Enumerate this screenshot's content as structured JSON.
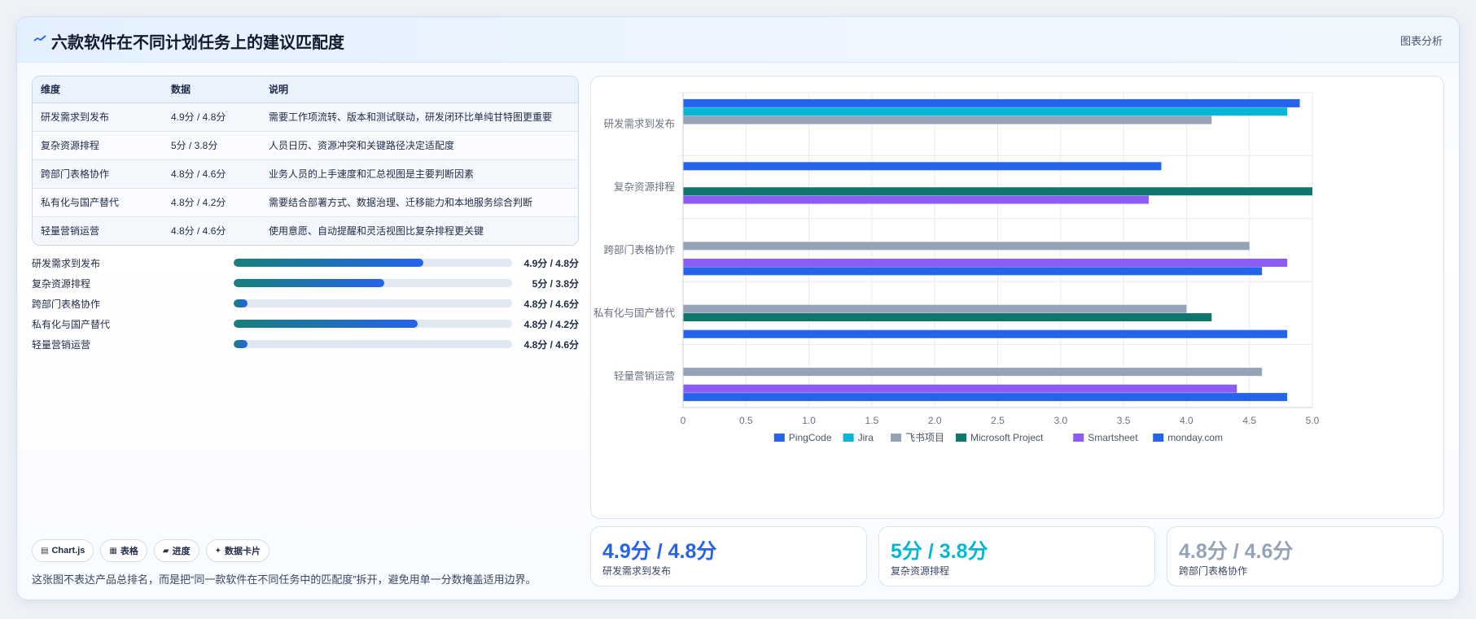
{
  "header": {
    "title": "六款软件在不同计划任务上的建议匹配度",
    "action_label": "图表分析"
  },
  "table": {
    "columns": [
      "维度",
      "数据",
      "说明"
    ],
    "rows": [
      {
        "dimension": "研发需求到发布",
        "data": "4.9分 / 4.8分",
        "note": "需要工作项流转、版本和测试联动，研发闭环比单纯甘特图更重要"
      },
      {
        "dimension": "复杂资源排程",
        "data": "5分 / 3.8分",
        "note": "人员日历、资源冲突和关键路径决定适配度"
      },
      {
        "dimension": "跨部门表格协作",
        "data": "4.8分 / 4.6分",
        "note": "业务人员的上手速度和汇总视图是主要判断因素"
      },
      {
        "dimension": "私有化与国产替代",
        "data": "4.8分 / 4.2分",
        "note": "需要结合部署方式、数据治理、迁移能力和本地服务综合判断"
      },
      {
        "dimension": "轻量营销运营",
        "data": "4.8分 / 4.6分",
        "note": "使用意愿、自动提醒和灵活视图比复杂排程更关键"
      }
    ]
  },
  "progress": [
    {
      "label": "研发需求到发布",
      "value": "4.9分 / 4.8分",
      "fraction": 0.68
    },
    {
      "label": "复杂资源排程",
      "value": "5分 / 3.8分",
      "fraction": 0.54
    },
    {
      "label": "跨部门表格协作",
      "value": "4.8分 / 4.6分",
      "fraction": 0.05
    },
    {
      "label": "私有化与国产替代",
      "value": "4.8分 / 4.2分",
      "fraction": 0.66
    },
    {
      "label": "轻量营销运营",
      "value": "4.8分 / 4.6分",
      "fraction": 0.05
    }
  ],
  "chips": [
    {
      "icon": "▤",
      "label": "Chart.js"
    },
    {
      "icon": "▦",
      "label": "表格"
    },
    {
      "icon": "▰",
      "label": "进度"
    },
    {
      "icon": "✦",
      "label": "数据卡片"
    }
  ],
  "footnote": "这张图不表达产品总排名，而是把“同一款软件在不同任务中的匹配度”拆开，避免用单一分数掩盖适用边界。",
  "kpis": [
    {
      "value": "4.9分 / 4.8分",
      "label": "研发需求到发布",
      "color": "#2563eb"
    },
    {
      "value": "5分 / 3.8分",
      "label": "复杂资源排程",
      "color": "#06b6d4"
    },
    {
      "value": "4.8分 / 4.6分",
      "label": "跨部门表格协作",
      "color": "#94a3b8"
    }
  ],
  "chart_data": {
    "type": "bar",
    "orientation": "horizontal",
    "categories": [
      "研发需求到发布",
      "复杂资源排程",
      "跨部门表格协作",
      "私有化与国产替代",
      "轻量营销运营"
    ],
    "series": [
      {
        "name": "PingCode",
        "color": "#2563eb",
        "values": [
          4.9,
          3.8,
          null,
          null,
          null
        ]
      },
      {
        "name": "Jira",
        "color": "#06b6d4",
        "values": [
          4.8,
          null,
          null,
          null,
          null
        ]
      },
      {
        "name": "飞书项目",
        "color": "#94a3b8",
        "values": [
          4.2,
          null,
          4.5,
          4.0,
          4.6
        ]
      },
      {
        "name": "Microsoft Project",
        "color": "#0f766e",
        "values": [
          null,
          5.0,
          null,
          4.2,
          null
        ]
      },
      {
        "name": "Smartsheet",
        "color": "#8b5cf6",
        "values": [
          null,
          3.7,
          4.8,
          null,
          4.4
        ]
      },
      {
        "name": "monday.com",
        "color": "#2563eb",
        "values": [
          null,
          null,
          4.6,
          4.8,
          4.8
        ]
      }
    ],
    "xlim": [
      0,
      5
    ],
    "xticks": [
      "0",
      "0.5",
      "1.0",
      "1.5",
      "2.0",
      "2.5",
      "3.0",
      "3.5",
      "4.0",
      "4.5",
      "5.0"
    ],
    "grid": true,
    "legend": "bottom"
  }
}
